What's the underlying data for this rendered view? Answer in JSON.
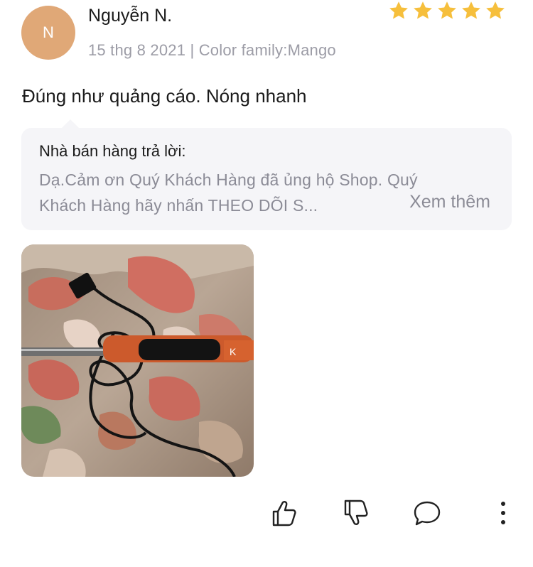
{
  "review": {
    "avatar_initial": "N",
    "reviewer_name": "Nguyễn N.",
    "rating": 5,
    "rating_max": 5,
    "star_color": "#f6bf3c",
    "date": "15 thg 8 2021",
    "separator": "|",
    "variant_label": "Color family:",
    "variant_value": "Mango",
    "text": "Đúng như quảng cáo. Nóng nhanh"
  },
  "seller_reply": {
    "title": "Nhà bán hàng trả lời:",
    "line1": "Dạ.Cảm ơn Quý Khách Hàng đã ủng hộ Shop. Quý",
    "line2": "Khách Hàng hãy nhấn THEO DÕI S...",
    "see_more": "Xem thêm"
  },
  "photo": {
    "icon": "review-photo-soldering-iron"
  },
  "actions": [
    {
      "name": "like-button",
      "icon": "thumbs-up-icon"
    },
    {
      "name": "dislike-button",
      "icon": "thumbs-down-icon"
    },
    {
      "name": "comment-button",
      "icon": "speech-bubble-icon"
    },
    {
      "name": "more-options-button",
      "icon": "vertical-ellipsis-icon"
    }
  ]
}
